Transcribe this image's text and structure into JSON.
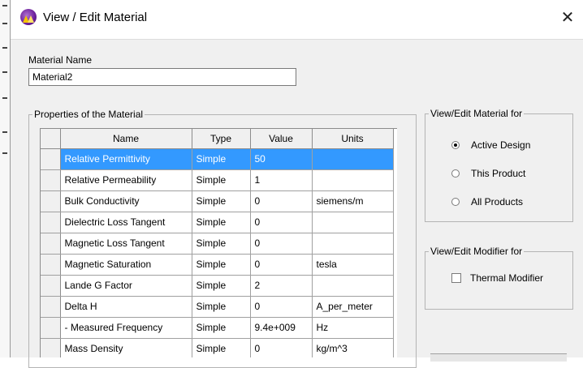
{
  "window": {
    "title": "View / Edit Material",
    "close_glyph": "✕",
    "app_icon": "ansys-hfss-icon"
  },
  "material_name": {
    "label": "Material Name",
    "value": "Material2"
  },
  "properties_group": {
    "legend": "Properties of the Material",
    "headers": [
      "Name",
      "Type",
      "Value",
      "Units"
    ],
    "selected_row_color": "#3399ff",
    "rows": [
      {
        "name": "Relative Permittivity",
        "type": "Simple",
        "value": "50",
        "units": "",
        "selected": true
      },
      {
        "name": "Relative Permeability",
        "type": "Simple",
        "value": "1",
        "units": ""
      },
      {
        "name": "Bulk Conductivity",
        "type": "Simple",
        "value": "0",
        "units": "siemens/m"
      },
      {
        "name": "Dielectric Loss Tangent",
        "type": "Simple",
        "value": "0",
        "units": ""
      },
      {
        "name": "Magnetic Loss Tangent",
        "type": "Simple",
        "value": "0",
        "units": ""
      },
      {
        "name": "Magnetic Saturation",
        "type": "Simple",
        "value": "0",
        "units": "tesla"
      },
      {
        "name": "Lande G Factor",
        "type": "Simple",
        "value": "2",
        "units": ""
      },
      {
        "name": "Delta H",
        "type": "Simple",
        "value": "0",
        "units": "A_per_meter"
      },
      {
        "name": "- Measured Frequency",
        "type": "Simple",
        "value": "9.4e+009",
        "units": "Hz"
      },
      {
        "name": "Mass Density",
        "type": "Simple",
        "value": "0",
        "units": "kg/m^3"
      }
    ]
  },
  "view_edit_for": {
    "legend": "View/Edit Material for",
    "options": [
      {
        "label": "Active Design",
        "checked": true
      },
      {
        "label": "This Product",
        "checked": false
      },
      {
        "label": "All Products",
        "checked": false
      }
    ]
  },
  "modifier_for": {
    "legend": "View/Edit Modifier for",
    "checkbox_label": "Thermal Modifier",
    "checked": false
  }
}
